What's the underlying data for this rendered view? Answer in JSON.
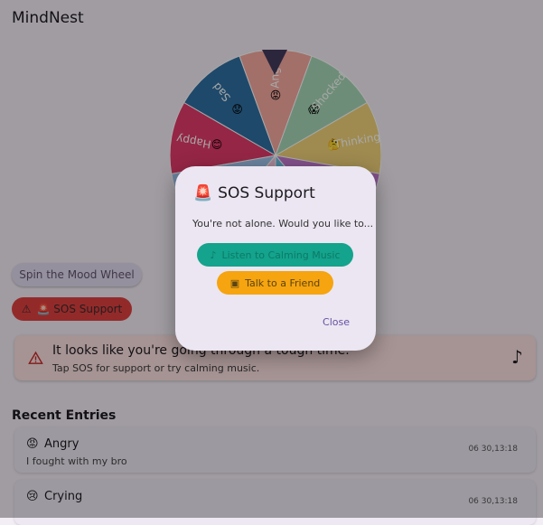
{
  "app": {
    "title": "MindNest"
  },
  "wheel": {
    "slices": [
      {
        "label": "Angry",
        "emoji": "😡",
        "color": "#f6a9a0"
      },
      {
        "label": "Shocked",
        "emoji": "😱",
        "color": "#a7d7b7"
      },
      {
        "label": "Thinking",
        "emoji": "🤔",
        "color": "#f2d37a"
      },
      {
        "label": "",
        "emoji": "😄",
        "color": "#c57bd3"
      },
      {
        "label": "",
        "emoji": "😐",
        "color": "#6ec3e8"
      },
      {
        "label": "",
        "emoji": "😊",
        "color": "#f7c7e1"
      },
      {
        "label": "",
        "emoji": "🙂",
        "color": "#a3c7f0"
      },
      {
        "label": "Happy",
        "emoji": "😊",
        "color": "#e23a6a"
      },
      {
        "label": "Sad",
        "emoji": "😟",
        "color": "#2f6fa2"
      }
    ],
    "pointer_color": "#433b5c"
  },
  "buttons": {
    "spin": "Spin the Mood Wheel",
    "sos": "🚨 SOS Support"
  },
  "alert": {
    "message": "It looks like you're going through a tough time.",
    "subtext": "Tap SOS for support or try calming music.",
    "note_icon": "music-note-icon"
  },
  "recent": {
    "title": "Recent Entries",
    "entries": [
      {
        "emoji": "😡",
        "mood": "Angry",
        "note": "I fought with my bro",
        "time": "06 30,13:18"
      },
      {
        "emoji": "😢",
        "mood": "Crying",
        "note": "",
        "time": "06 30,13:18"
      }
    ]
  },
  "dialog": {
    "emoji": "🚨",
    "title": "SOS Support",
    "text": "You're not alone. Would you like to...",
    "listen": "Listen to Calming Music",
    "friend": "Talk to a Friend",
    "close": "Close"
  },
  "colors": {
    "primary": "#6650a4",
    "sos": "#e04040",
    "music": "#14a38c",
    "friend": "#f6a40f"
  }
}
